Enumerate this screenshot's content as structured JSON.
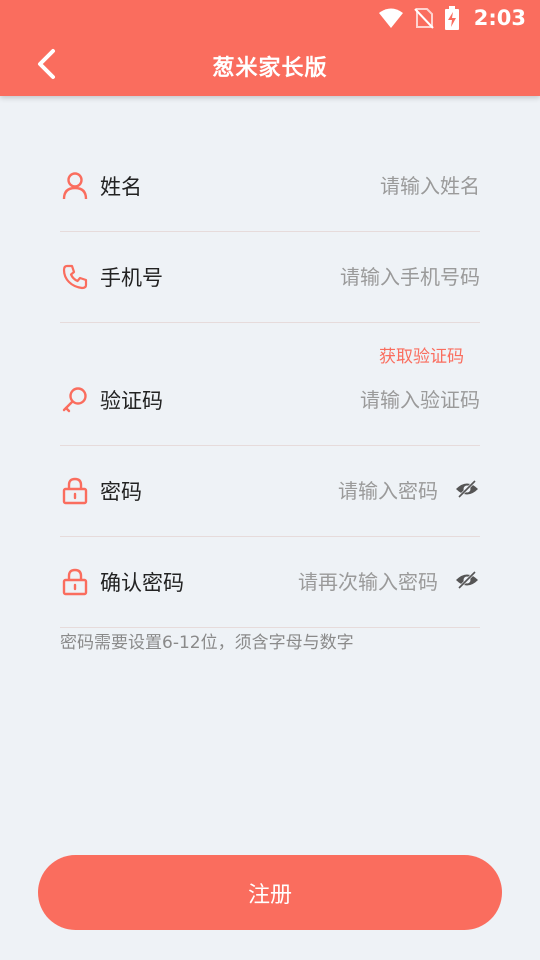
{
  "status_bar": {
    "time": "2:03",
    "icons": [
      "wifi-icon",
      "no-sim-icon",
      "battery-charging-icon"
    ]
  },
  "header": {
    "title": "葱米家长版",
    "back_icon": "chevron-left-icon"
  },
  "form": {
    "name": {
      "label": "姓名",
      "placeholder": "请输入姓名",
      "value": "",
      "icon": "user-icon"
    },
    "phone": {
      "label": "手机号",
      "placeholder": "请输入手机号码",
      "value": "",
      "icon": "phone-icon"
    },
    "get_code_label": "获取验证码",
    "code": {
      "label": "验证码",
      "placeholder": "请输入验证码",
      "value": "",
      "icon": "key-icon"
    },
    "password": {
      "label": "密码",
      "placeholder": "请输入密码",
      "value": "",
      "icon": "lock-icon"
    },
    "confirm_password": {
      "label": "确认密码",
      "placeholder": "请再次输入密码",
      "value": "",
      "icon": "lock-icon"
    },
    "hint": "密码需要设置6-12位，须含字母与数字"
  },
  "register_label": "注册",
  "colors": {
    "accent": "#fa6d5e",
    "background": "#eef2f6"
  }
}
